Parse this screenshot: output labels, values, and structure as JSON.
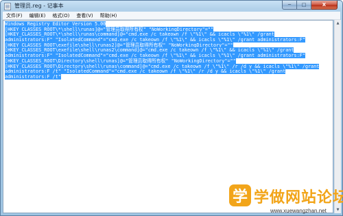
{
  "window": {
    "title": "管理员.reg - 记事本",
    "caption": {
      "minimize": "─",
      "maximize": "□",
      "close": "X"
    }
  },
  "menu": {
    "items": [
      "文件(F)",
      "编辑(E)",
      "格式(O)",
      "查看(V)",
      "帮助(H)"
    ]
  },
  "editor": {
    "lines": [
      "Windows Registry Editor Version 5.00",
      "[HKEY_CLASSES_ROOT\\*\\shell\\runas]@=\"管理员取得所有权\" \"NoWorkingDirectory\"=\"\"",
      "[HKEY_CLASSES_ROOT\\*\\shell\\runas\\command]@=\"cmd.exe /c takeown /f \\\"%1\\\" && icacls \\\"%1\\\" /grant",
      "administrators:F\" \"IsolatedCommand\"=\"cmd.exe /c takeown /f \\\"%1\\\" && icacls \\\"%1\\\" /grant administrators:F\"",
      "[HKEY_CLASSES_ROOT\\exefile\\shell\\runas2]@=\"管理员取得所有权\" \"NoWorkingDirectory\"=\"\"",
      "[HKEY_CLASSES_ROOT\\exefile\\shell\\runas2\\command]@=\"cmd.exe /c takeown /f \\\"%1\\\" && icacls \\\"%1\\\" /grant",
      "administrators:F\" \"IsolatedCommand\"=\"cmd.exe /c takeown /f \\\"%1\\\" && icacls \\\"%1\\\" /grant administrators:F\"",
      "[HKEY_CLASSES_ROOT\\Directory\\shell\\runas]@=\"管理员取得所有权\" \"NoWorkingDirectory\"=\"\"",
      "[HKEY_CLASSES_ROOT\\Directory\\shell\\runas\\command]@=\"cmd.exe /c takeown /f \\\"%1\\\" /r /d y && icacls \\\"%1\\\" /grant",
      "administrators:F /t\" \"IsolatedCommand\"=\"cmd.exe /c takeown /f \\\"%1\\\" /r /d y && icacls \\\"%1\\\" /grant",
      "administrators:F /t\""
    ],
    "selection_color": "#3399ff"
  },
  "scrollbar": {
    "up_arrow": "▲",
    "down_arrow": "▼"
  },
  "watermark": {
    "logo_char": "学",
    "name": "学做网站论坛",
    "url": "www.xuewangzhan.net",
    "color": "#f2a51a"
  }
}
